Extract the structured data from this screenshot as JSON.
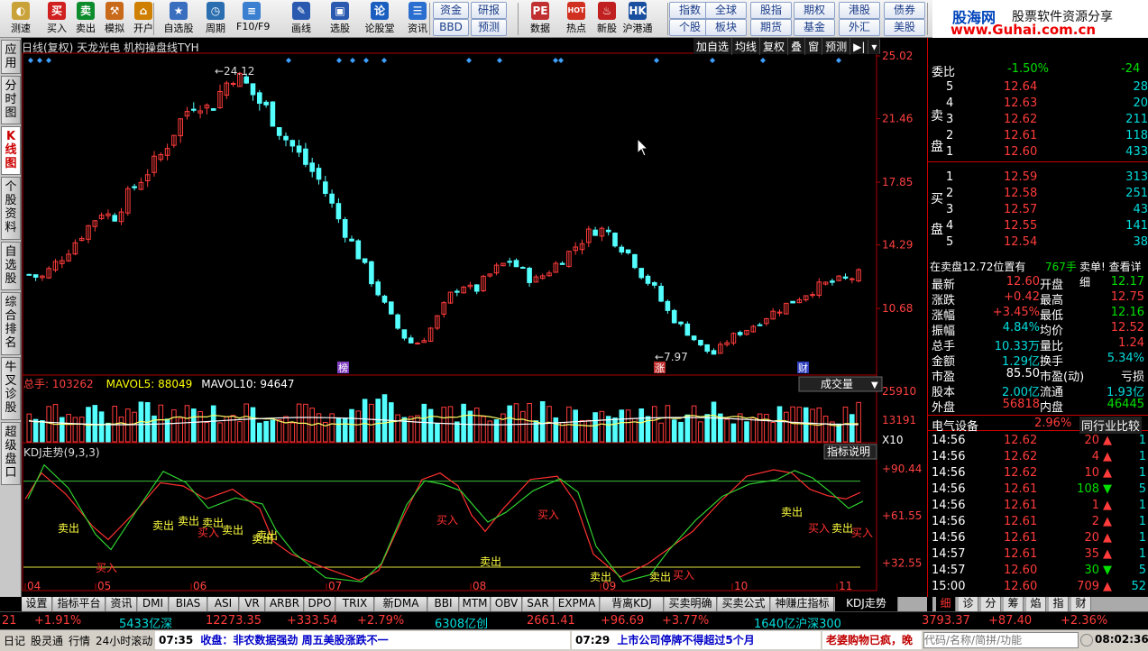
{
  "toolbar": {
    "items": [
      {
        "id": "refresh",
        "label": "测速",
        "color": "#caa23a",
        "glyph": "◐",
        "icon": "speed-icon"
      },
      {
        "id": "buy",
        "label": "买入",
        "color": "#d02020",
        "glyph": "买",
        "icon": "buy-icon"
      },
      {
        "id": "sell",
        "label": "卖出",
        "color": "#0c8c2c",
        "glyph": "卖",
        "icon": "sell-icon"
      },
      {
        "id": "sim",
        "label": "模拟",
        "color": "#c86a1a",
        "glyph": "⚒",
        "icon": "simulate-icon"
      },
      {
        "id": "open",
        "label": "开户",
        "color": "#d08000",
        "glyph": "⌂",
        "icon": "open-account-icon"
      },
      {
        "id": "watch",
        "label": "自选股",
        "color": "#3a6fc0",
        "glyph": "★",
        "icon": "watchlist-icon"
      },
      {
        "id": "period",
        "label": "周期",
        "color": "#2c6fb0",
        "glyph": "◷",
        "icon": "period-icon"
      },
      {
        "id": "f10",
        "label": "F10/F9",
        "color": "#3a7fd0",
        "glyph": "≡",
        "icon": "f10-icon"
      },
      {
        "id": "draw",
        "label": "画线",
        "color": "#2a5ab0",
        "glyph": "✎",
        "icon": "draw-icon"
      },
      {
        "id": "select",
        "label": "选股",
        "color": "#2a5ab0",
        "glyph": "▣",
        "icon": "stock-select-icon"
      },
      {
        "id": "forum",
        "label": "论股堂",
        "color": "#1a5fc0",
        "glyph": "论",
        "icon": "forum-icon"
      },
      {
        "id": "news",
        "label": "资讯",
        "color": "#2a6fd0",
        "glyph": "☰",
        "icon": "news-icon"
      },
      {
        "id": "data",
        "label": "数据",
        "color": "#c03030",
        "glyph": "PE",
        "icon": "data-icon"
      },
      {
        "id": "hot",
        "label": "热点",
        "color": "#d03020",
        "glyph": "HOT",
        "icon": "hot-icon"
      },
      {
        "id": "newshare",
        "label": "新股",
        "color": "#c02020",
        "glyph": "♨",
        "icon": "new-share-icon"
      },
      {
        "id": "hk",
        "label": "沪港通",
        "color": "#1a4fa0",
        "glyph": "HK",
        "icon": "hk-connect-icon"
      }
    ],
    "grid": [
      "资金",
      "研报",
      "指数",
      "全球",
      "股指",
      "期权",
      "港股",
      "债券",
      "BBD",
      "预测",
      "个股",
      "板块",
      "期货",
      "基金",
      "外汇",
      "美股"
    ]
  },
  "logo": {
    "site": "股海网",
    "slogan": "股票软件资源分享",
    "url": "www.Guhai.com.cn"
  },
  "left_tabs": [
    "应用",
    "分时图",
    "K线图",
    "个股资料",
    "自选股",
    "综合排名",
    "牛叉诊股",
    "超级盘口"
  ],
  "chart": {
    "title": "日线(复权)  天龙光电  机构操盘线TYH",
    "top_buttons": [
      "加自选",
      "均线",
      "复权",
      "叠",
      "窗",
      "预测",
      "▶|",
      "▾"
    ],
    "price_axis": [
      "25.02",
      "21.46",
      "17.85",
      "14.29",
      "10.68"
    ],
    "high_label": "24.12",
    "low_label": "7.97",
    "badges": [
      "榜",
      "涨",
      "财"
    ],
    "vol_header": {
      "total": "总手: 103262",
      "mavol5": "MAVOL5: 88049",
      "mavol10": "MAVOL10: 94647"
    },
    "vol_button": "成交量",
    "vol_axis": [
      "25910",
      "13191",
      "X10"
    ],
    "kdj_header": "KDJ走势(9,3,3)",
    "kdj_button": "指标说明",
    "kdj_axis": [
      "+90.44",
      "+61.55",
      "+32.55"
    ],
    "months": [
      "04",
      "05",
      "06",
      "07",
      "08",
      "09",
      "10",
      "11"
    ],
    "signals": [
      "卖出",
      "买入",
      "卖出",
      "卖出",
      "买入",
      "卖出",
      "卖出",
      "买入",
      "卖出",
      "买入",
      "卖出",
      "买入",
      "卖出",
      "买入",
      "卖出",
      "买入",
      "卖出",
      "买入",
      "卖出",
      "卖出",
      "买入"
    ]
  },
  "chart_data": {
    "type": "candlestick",
    "price_ylim": [
      7.0,
      25.02
    ],
    "kline_high": 24.12,
    "kline_low": 7.97,
    "close_series": [
      12.6,
      12.4,
      13.1,
      13.8,
      14.6,
      15.4,
      16.2,
      15.8,
      16.9,
      17.8,
      18.6,
      19.4,
      20.7,
      21.8,
      22.6,
      21.9,
      23.1,
      24.0,
      23.4,
      22.5,
      21.8,
      20.6,
      19.8,
      18.9,
      18.1,
      16.8,
      15.4,
      14.2,
      12.9,
      11.6,
      10.3,
      9.2,
      8.6,
      9.1,
      10.2,
      11.4,
      12.1,
      11.6,
      12.4,
      13.0,
      13.4,
      12.8,
      12.2,
      12.7,
      13.3,
      13.9,
      14.6,
      15.2,
      15.1,
      14.4,
      13.7,
      12.6,
      11.8,
      10.6,
      9.8,
      9.2,
      8.4,
      8.1,
      8.8,
      9.3,
      9.6,
      10.1,
      10.5,
      10.9,
      11.3,
      11.7,
      12.0,
      12.2,
      12.3,
      12.6
    ],
    "volume_ylim": [
      0,
      25910
    ],
    "volume_stats": {
      "total": 103262,
      "mavol5": 88049,
      "mavol10": 94647
    },
    "kdj_ylim": [
      20,
      95
    ],
    "kdj_levels": [
      90.44,
      61.55,
      32.55
    ]
  },
  "quote": {
    "weibi_label": "委比",
    "weibi": "-1.50%",
    "weicha": "-24",
    "sell_label": "卖盘",
    "buy_label": "买盘",
    "sell": [
      {
        "n": "5",
        "p": "12.64",
        "v": "28"
      },
      {
        "n": "4",
        "p": "12.63",
        "v": "20"
      },
      {
        "n": "3",
        "p": "12.62",
        "v": "211"
      },
      {
        "n": "2",
        "p": "12.61",
        "v": "118"
      },
      {
        "n": "1",
        "p": "12.60",
        "v": "433"
      }
    ],
    "buy": [
      {
        "n": "1",
        "p": "12.59",
        "v": "313"
      },
      {
        "n": "2",
        "p": "12.58",
        "v": "251"
      },
      {
        "n": "3",
        "p": "12.57",
        "v": "43"
      },
      {
        "n": "4",
        "p": "12.55",
        "v": "141"
      },
      {
        "n": "5",
        "p": "12.54",
        "v": "38"
      }
    ],
    "pos_text": "在卖盘12.72位置有",
    "pos_vol": "767手",
    "pos_link": "卖单! 查看详细",
    "stats": [
      {
        "l1": "最新",
        "v1": "12.60",
        "c1": "red",
        "l2": "开盘",
        "v2": "12.17",
        "c2": "green"
      },
      {
        "l1": "涨跌",
        "v1": "+0.42",
        "c1": "red",
        "l2": "最高",
        "v2": "12.75",
        "c2": "red"
      },
      {
        "l1": "涨幅",
        "v1": "+3.45%",
        "c1": "red",
        "l2": "最低",
        "v2": "12.16",
        "c2": "green"
      },
      {
        "l1": "振幅",
        "v1": "4.84%",
        "c1": "cyan",
        "l2": "均价",
        "v2": "12.52",
        "c2": "red"
      },
      {
        "l1": "总手",
        "v1": "10.33万",
        "c1": "cyan",
        "l2": "量比",
        "v2": "1.24",
        "c2": "red"
      },
      {
        "l1": "金额",
        "v1": "1.29亿",
        "c1": "cyan",
        "l2": "换手",
        "v2": "5.34%",
        "c2": "cyan"
      },
      {
        "l1": "市盈",
        "v1": "85.50",
        "c1": "white",
        "l2": "市盈(动)",
        "v2": "亏损",
        "c2": "white"
      },
      {
        "l1": "股本",
        "v1": "2.00亿",
        "c1": "cyan",
        "l2": "流通",
        "v2": "1.93亿",
        "c2": "cyan"
      },
      {
        "l1": "外盘",
        "v1": "56818",
        "c1": "red",
        "l2": "内盘",
        "v2": "46445",
        "c2": "green"
      }
    ],
    "industry": "电气设备",
    "industry_pct": "2.96%",
    "industry_btn": "同行业比较",
    "ticks": [
      {
        "t": "14:56",
        "p": "12.62",
        "v": "20",
        "d": "up",
        "n": "1"
      },
      {
        "t": "14:56",
        "p": "12.62",
        "v": "4",
        "d": "up",
        "n": "1"
      },
      {
        "t": "14:56",
        "p": "12.62",
        "v": "10",
        "d": "up",
        "n": "1"
      },
      {
        "t": "14:56",
        "p": "12.61",
        "v": "108",
        "d": "down",
        "n": "5"
      },
      {
        "t": "14:56",
        "p": "12.61",
        "v": "1",
        "d": "up",
        "n": "1"
      },
      {
        "t": "14:56",
        "p": "12.61",
        "v": "2",
        "d": "up",
        "n": "1"
      },
      {
        "t": "14:56",
        "p": "12.61",
        "v": "20",
        "d": "up",
        "n": "1"
      },
      {
        "t": "14:57",
        "p": "12.61",
        "v": "35",
        "d": "up",
        "n": "1"
      },
      {
        "t": "14:57",
        "p": "12.60",
        "v": "30",
        "d": "down",
        "n": "5"
      },
      {
        "t": "15:00",
        "p": "12.60",
        "v": "709",
        "d": "up",
        "n": "52"
      }
    ]
  },
  "bottom_tabs": [
    "设置",
    "指标平台",
    "资讯",
    "DMI",
    "BIAS",
    "ASI",
    "VR",
    "ARBR",
    "DPO",
    "TRIX",
    "新DMA",
    "BBI",
    "MTM",
    "OBV",
    "SAR",
    "EXPMA",
    "背离KDJ",
    "买卖明确",
    "买卖公式",
    "神赚庄指标",
    "KDJ走势"
  ],
  "right_tabs": [
    "细",
    "诊",
    "分",
    "筹",
    "焰",
    "指",
    "财"
  ],
  "index_bar": {
    "a": "21",
    "b": "+1.91%",
    "c": "5433亿深",
    "d": "12273.35",
    "e": "+333.54",
    "f": "+2.79%",
    "g": "6308亿创",
    "h": "2661.41",
    "i": "+96.69",
    "j": "+3.77%",
    "k": "1640亿沪深300",
    "l": "3793.37",
    "m": "+87.40",
    "n": "+2.36%"
  },
  "status": {
    "items": [
      "日记",
      "股灵通",
      "行情",
      "24小时滚动"
    ],
    "news1_time": "07:35",
    "news1": "收盘：非农数据强劲 周五美股涨跌不一",
    "news2_time": "07:29",
    "news2": "上市公司停牌不得超过5个月",
    "news3": "老婆购物已疯，晚",
    "search_placeholder": "代码/名称/简拼/功能",
    "clock": "08:02:36"
  }
}
